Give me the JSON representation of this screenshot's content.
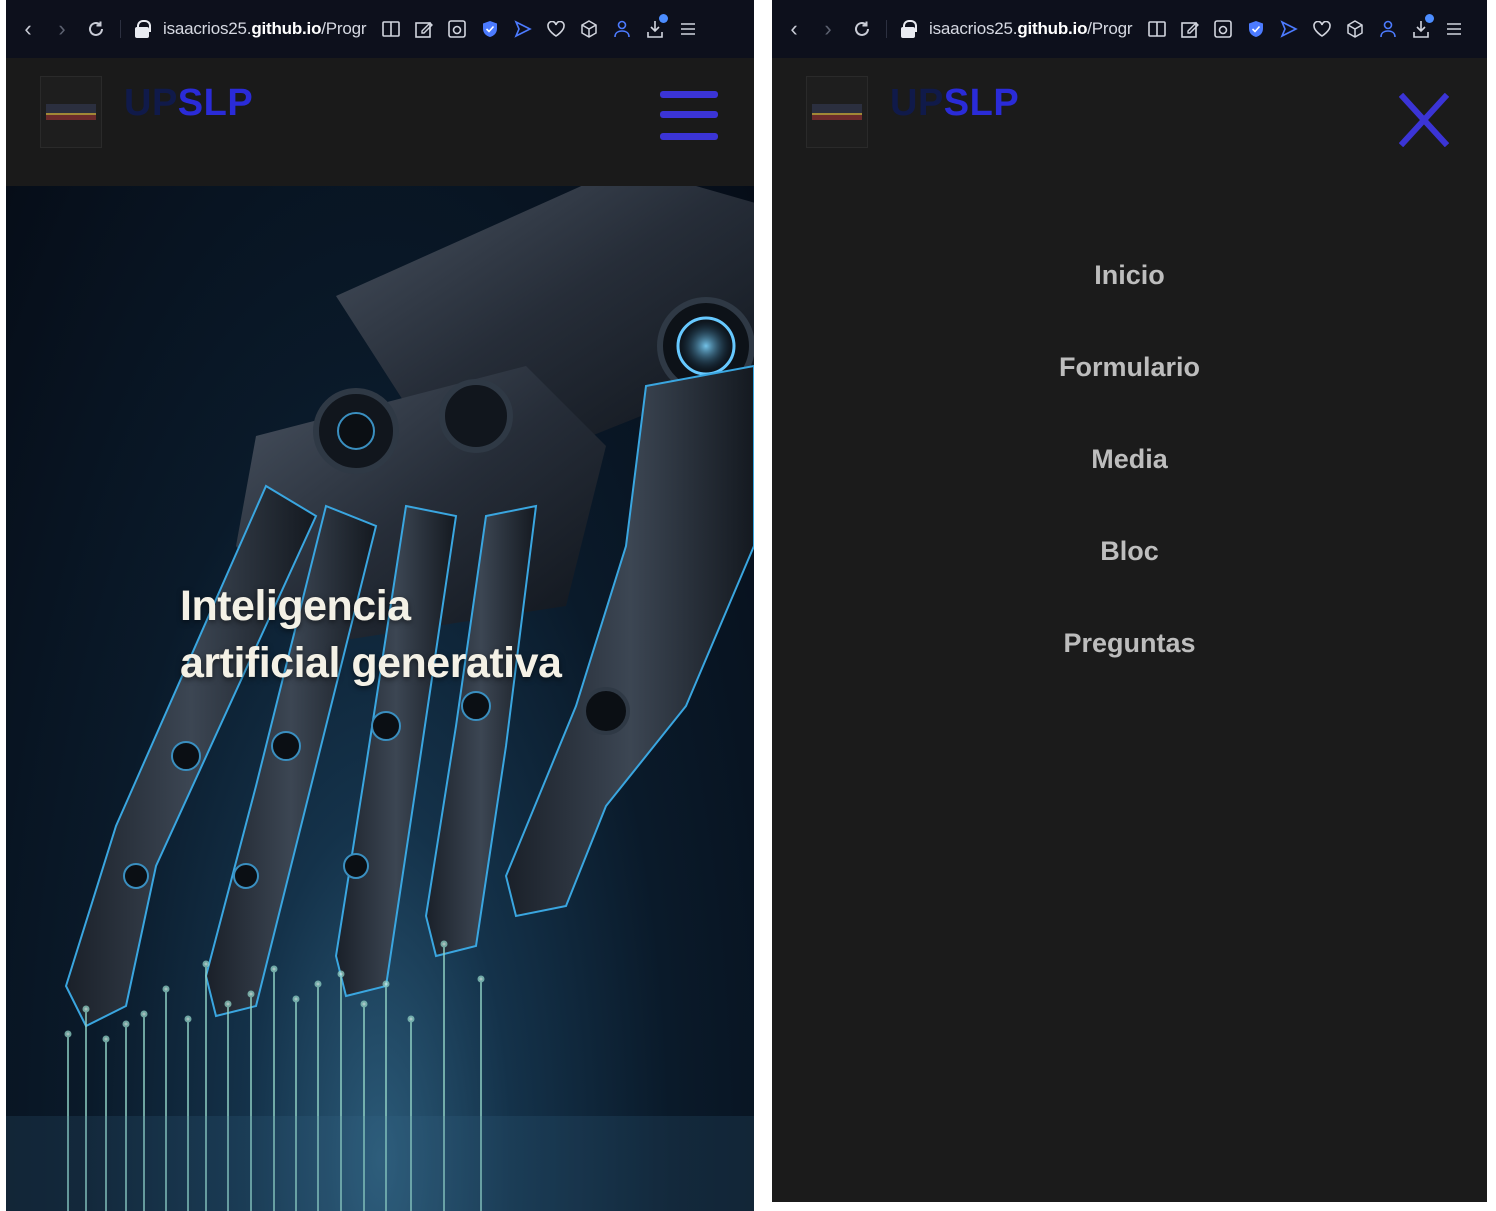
{
  "browser": {
    "url_prefix": "isaacrios25.",
    "url_domain": "github.io",
    "url_path": "/Progr",
    "toolbar_icons": [
      "reader-view-icon",
      "edit-icon",
      "screenshot-icon",
      "shield-icon",
      "send-icon",
      "heart-icon",
      "cube-icon",
      "profile-icon",
      "download-icon",
      "menu-icon"
    ],
    "accent_color": "#4c8dff"
  },
  "site": {
    "brand_prefix": "UP",
    "brand_suffix": "SLP",
    "brand_prefix_color": "#101a4a",
    "brand_suffix_color": "#2a2bd8",
    "accent_color": "#3b34d6"
  },
  "hero": {
    "title_line1": "Inteligencia",
    "title_line2": "artificial generativa"
  },
  "menu": {
    "items": [
      {
        "label": "Inicio"
      },
      {
        "label": "Formulario"
      },
      {
        "label": "Media"
      },
      {
        "label": "Bloc"
      },
      {
        "label": "Preguntas"
      }
    ]
  }
}
